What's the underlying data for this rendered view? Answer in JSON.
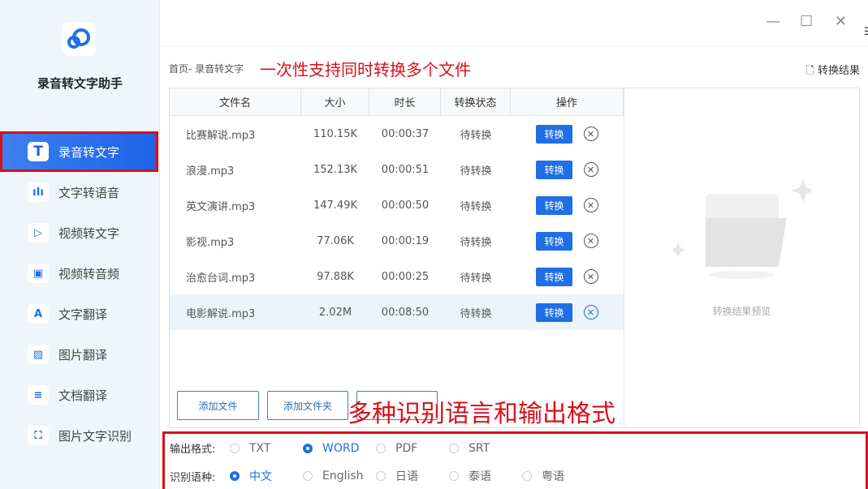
{
  "app": {
    "title": "录音转文字助手"
  },
  "sidebar": {
    "items": [
      {
        "label": "录音转文字",
        "icon": "T",
        "active": true
      },
      {
        "label": "文字转语音",
        "icon": "ıIı"
      },
      {
        "label": "视频转文字",
        "icon": "▷"
      },
      {
        "label": "视频转音频",
        "icon": "▣"
      },
      {
        "label": "文字翻译",
        "icon": "A"
      },
      {
        "label": "图片翻译",
        "icon": "▨"
      },
      {
        "label": "文档翻译",
        "icon": "≡"
      },
      {
        "label": "图片文字识别",
        "icon": "⛶"
      }
    ]
  },
  "topbar": {
    "more": "更多"
  },
  "breadcrumb": "首页- 录音转文字",
  "annotations": {
    "top": "一次性支持同时转换多个文件",
    "bottom": "多种识别语言和输出格式"
  },
  "result_link": "转换结果",
  "table": {
    "headers": [
      "文件名",
      "大小",
      "时长",
      "转换状态",
      "操作"
    ],
    "convert_label": "转换",
    "rows": [
      {
        "name": "比赛解说.mp3",
        "size": "110.15K",
        "duration": "00:00:37",
        "status": "待转换"
      },
      {
        "name": "浪漫.mp3",
        "size": "152.13K",
        "duration": "00:00:51",
        "status": "待转换"
      },
      {
        "name": "英文演讲.mp3",
        "size": "147.49K",
        "duration": "00:00:50",
        "status": "待转换"
      },
      {
        "name": "影视.mp3",
        "size": "77.06K",
        "duration": "00:00:19",
        "status": "待转换"
      },
      {
        "name": "治愈台词.mp3",
        "size": "97.88K",
        "duration": "00:00:25",
        "status": "待转换"
      },
      {
        "name": "电影解说.mp3",
        "size": "2.02M",
        "duration": "00:08:50",
        "status": "待转换",
        "selected": true
      }
    ]
  },
  "preview": {
    "text": "转换结果预览"
  },
  "buttons": {
    "add_file": "添加文件",
    "add_folder": "添加文件夹"
  },
  "options": {
    "format": {
      "label": "输出格式:",
      "items": [
        "TXT",
        "WORD",
        "PDF",
        "SRT"
      ],
      "selected": "WORD"
    },
    "language": {
      "label": "识别语种:",
      "items": [
        "中文",
        "English",
        "日语",
        "泰语",
        "粤语"
      ],
      "selected": "中文"
    }
  }
}
